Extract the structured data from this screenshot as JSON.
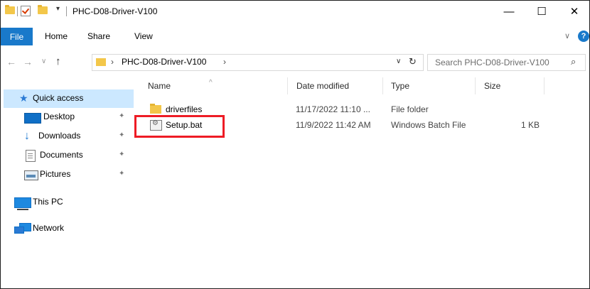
{
  "titlebar": {
    "title": "PHC-D08-Driver-V100",
    "dropdown_glyph": "▾",
    "minimize": "—",
    "maximize": "☐",
    "close": "✕"
  },
  "ribbon": {
    "tabs": [
      "File",
      "Home",
      "Share",
      "View"
    ],
    "expand_glyph": "∨",
    "help_glyph": "?"
  },
  "address": {
    "path_segment": "PHC-D08-Driver-V100",
    "separator": "›",
    "dropdown_glyph": "∨",
    "refresh_glyph": "↻"
  },
  "search": {
    "placeholder": "Search PHC-D08-Driver-V100",
    "icon_glyph": "⌕"
  },
  "nav": {
    "back_glyph": "←",
    "forward_glyph": "→",
    "recent_glyph": "∨",
    "up_glyph": "↑",
    "pin_glyph": "✦",
    "items": [
      {
        "label": "Quick access"
      },
      {
        "label": "Desktop"
      },
      {
        "label": "Downloads"
      },
      {
        "label": "Documents"
      },
      {
        "label": "Pictures"
      },
      {
        "label": "This PC"
      },
      {
        "label": "Network"
      }
    ]
  },
  "columns": {
    "name": "Name",
    "date": "Date modified",
    "type": "Type",
    "size": "Size",
    "sort_glyph": "^"
  },
  "files": [
    {
      "name": "driverfiles",
      "date": "11/17/2022 11:10 ...",
      "type": "File folder",
      "size": ""
    },
    {
      "name": "Setup.bat",
      "date": "11/9/2022 11:42 AM",
      "type": "Windows Batch File",
      "size": "1 KB"
    }
  ],
  "colors": {
    "accent": "#1979ca",
    "selection": "#cce8ff",
    "highlight_box": "#ee1c25",
    "folder": "#f3c74a"
  }
}
